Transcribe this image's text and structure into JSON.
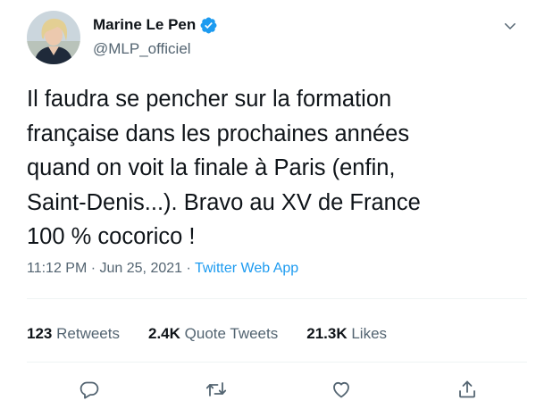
{
  "author": {
    "name": "Marine Le Pen",
    "handle": "@MLP_officiel",
    "verified": true,
    "verified_color": "#1d9bf0"
  },
  "tweet": {
    "text": "Il faudra se pencher sur la formation\nfrançaise dans les prochaines années\nquand on voit la finale à Paris (enfin,\nSaint-Denis...). Bravo au XV de France\n100 % cocorico !"
  },
  "meta": {
    "time": "11:12 PM",
    "separator": " · ",
    "date": "Jun 25, 2021",
    "source": "Twitter Web App"
  },
  "stats": {
    "retweets_count": "123",
    "retweets_label": "Retweets",
    "quotes_count": "2.4K",
    "quotes_label": "Quote Tweets",
    "likes_count": "21.3K",
    "likes_label": "Likes"
  },
  "actions": [
    {
      "icon": "reply-icon"
    },
    {
      "icon": "retweet-icon"
    },
    {
      "icon": "like-icon"
    },
    {
      "icon": "share-icon"
    }
  ],
  "colors": {
    "text": "#0f1419",
    "secondary": "#536471",
    "accent": "#1d9bf0",
    "divider": "#eff3f4"
  }
}
